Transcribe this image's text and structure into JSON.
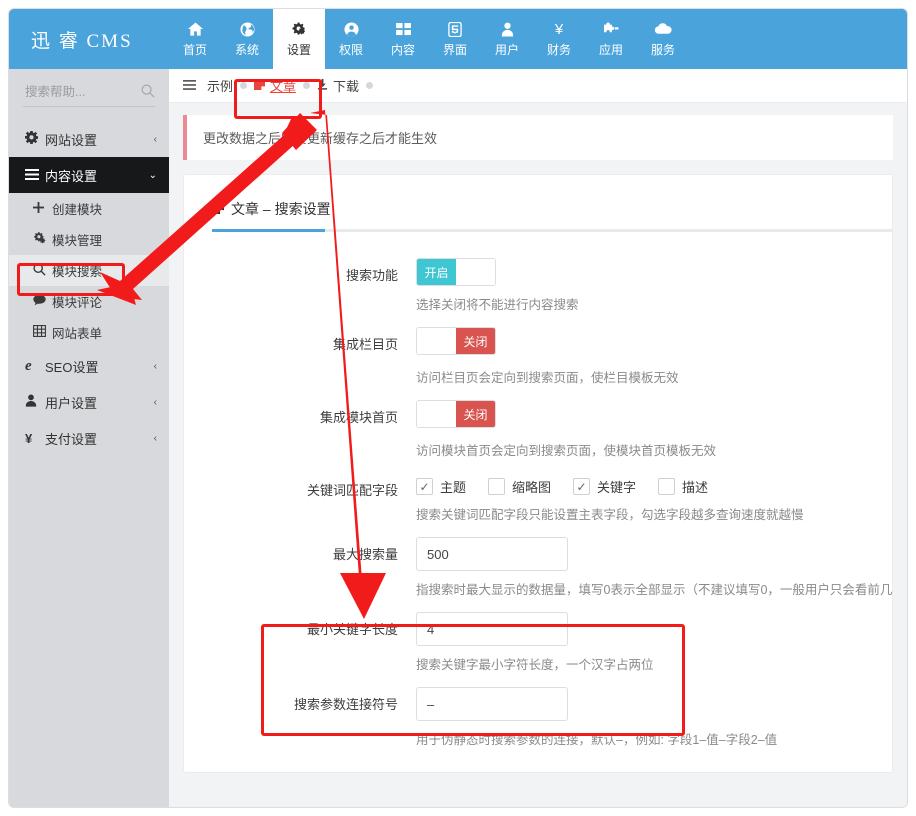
{
  "header": {
    "brand": "迅 睿 CMS",
    "nav": [
      {
        "label": "首页",
        "icon": "home-icon",
        "glyph": "⌂",
        "active": false
      },
      {
        "label": "系统",
        "icon": "globe-icon",
        "glyph": "◉",
        "active": false
      },
      {
        "label": "设置",
        "icon": "gears-icon",
        "glyph": "✿",
        "active": true
      },
      {
        "label": "权限",
        "icon": "user-circle-icon",
        "glyph": "◍",
        "active": false
      },
      {
        "label": "内容",
        "icon": "grid-icon",
        "glyph": "▩",
        "active": false
      },
      {
        "label": "界面",
        "icon": "html5-icon",
        "glyph": "▤",
        "active": false
      },
      {
        "label": "用户",
        "icon": "user-icon",
        "glyph": "♟",
        "active": false
      },
      {
        "label": "财务",
        "icon": "yen-icon",
        "glyph": "¥",
        "active": false
      },
      {
        "label": "应用",
        "icon": "puzzle-icon",
        "glyph": "⊹",
        "active": false
      },
      {
        "label": "服务",
        "icon": "cloud-icon",
        "glyph": "☁",
        "active": false
      }
    ]
  },
  "sidebar": {
    "search": {
      "placeholder": "搜索帮助...",
      "value": "",
      "icon": "search-icon"
    },
    "items": [
      {
        "label": "网站设置",
        "icon": "gear-icon",
        "glyph": "✹",
        "caret": "‹",
        "active": false
      },
      {
        "label": "内容设置",
        "icon": "bars-icon",
        "glyph": "☰",
        "caret": "⌄",
        "active": true
      }
    ],
    "sub_items": [
      {
        "label": "创建模块",
        "icon": "plus-icon",
        "glyph": "✚",
        "highlight": false
      },
      {
        "label": "模块管理",
        "icon": "cogs-icon",
        "glyph": "✿",
        "highlight": false
      },
      {
        "label": "模块搜索",
        "icon": "search-icon",
        "glyph": "⌕",
        "highlight": true
      },
      {
        "label": "模块评论",
        "icon": "comment-icon",
        "glyph": "✎",
        "highlight": false
      },
      {
        "label": "网站表单",
        "icon": "table-icon",
        "glyph": "▦",
        "highlight": false
      }
    ],
    "items_after": [
      {
        "label": "SEO设置",
        "icon": "explorer-icon",
        "glyph": "℮",
        "caret": "‹",
        "active": false
      },
      {
        "label": "用户设置",
        "icon": "user-icon",
        "glyph": "♟",
        "caret": "‹",
        "active": false
      },
      {
        "label": "支付设置",
        "icon": "yen-icon",
        "glyph": "¥",
        "caret": "‹",
        "active": false
      }
    ]
  },
  "tabbar": {
    "menu_icon": "bars-icon",
    "tabs": [
      {
        "label": "示例",
        "icon": "",
        "glyph": "",
        "selected": false
      },
      {
        "label": "文章",
        "icon": "file-icon",
        "glyph": "◪",
        "selected": true
      },
      {
        "label": "下载",
        "icon": "download-icon",
        "glyph": "⤓",
        "selected": false
      }
    ]
  },
  "alert": {
    "text": "更改数据之后需要更新缓存之后才能生效"
  },
  "card": {
    "title": "文章 – 搜索设置",
    "title_icon": "file-icon",
    "rows": [
      {
        "label": "搜索功能",
        "type": "toggle",
        "state": "on",
        "on_label": "开启",
        "off_label": "",
        "hint": "选择关闭将不能进行内容搜索"
      },
      {
        "label": "集成栏目页",
        "type": "toggle",
        "state": "off",
        "on_label": "",
        "off_label": "关闭",
        "hint": "访问栏目页会定向到搜索页面，使栏目模板无效"
      },
      {
        "label": "集成模块首页",
        "type": "toggle",
        "state": "off",
        "on_label": "",
        "off_label": "关闭",
        "hint": "访问模块首页会定向到搜索页面，使模块首页模板无效"
      },
      {
        "label": "关键词匹配字段",
        "type": "checkboxes",
        "options": [
          {
            "label": "主题",
            "checked": true
          },
          {
            "label": "缩略图",
            "checked": false
          },
          {
            "label": "关键字",
            "checked": true
          },
          {
            "label": "描述",
            "checked": false
          }
        ],
        "hint": "搜索关键词匹配字段只能设置主表字段，勾选字段越多查询速度就越慢"
      },
      {
        "label": "最大搜索量",
        "type": "text",
        "value": "500",
        "hint": "指搜索时最大显示的数据量，填写0表示全部显示（不建议填写0，一般用户只会看前几"
      },
      {
        "label": "最小关键字长度",
        "type": "text",
        "value": "4",
        "hint": "搜索关键字最小字符长度，一个汉字占两位"
      },
      {
        "label": "搜索参数连接符号",
        "type": "text",
        "value": "–",
        "hint": "用于伪静态时搜索参数的连接，默认–，例如: 字段1–值–字段2–值"
      }
    ]
  },
  "annotations": {
    "accent_red": "#f21b1b",
    "boxes": [
      {
        "name": "tab-highlight-box"
      },
      {
        "name": "module-search-highlight-box"
      },
      {
        "name": "min-keyword-length-highlight-box"
      }
    ],
    "arrows": [
      {
        "name": "arrow-to-module-search"
      },
      {
        "name": "arrow-to-min-keyword-length"
      }
    ]
  },
  "colors": {
    "brand_blue": "#4ba3db",
    "toggle_on": "#3ec6d3",
    "toggle_off": "#d9534f",
    "sidebar_bg": "#d8d9dc",
    "active_menu_bg": "#16181a"
  }
}
